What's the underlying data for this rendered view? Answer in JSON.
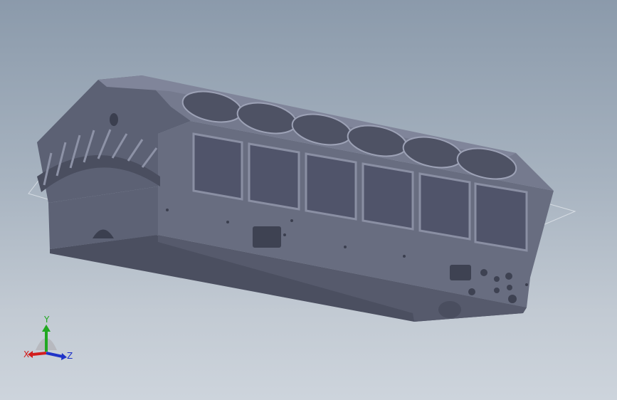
{
  "viewport": {
    "background_top": "#8b9aab",
    "background_bottom": "#cdd4dc",
    "model_color": "#656a7d",
    "model_dark": "#3e4252",
    "model_light": "#8a8fa3"
  },
  "triad": {
    "x_label": "X",
    "y_label": "Y",
    "z_label": "Z",
    "x_color": "#d21e1e",
    "y_color": "#21a821",
    "z_color": "#1f33c8"
  }
}
